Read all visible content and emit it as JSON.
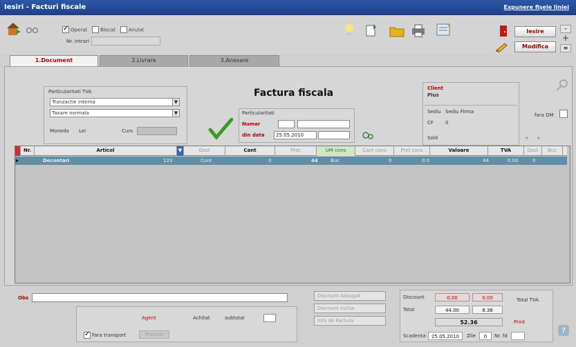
{
  "window": {
    "title": "Iesiri - Facturi fiscale",
    "top_link": "Expunere fișele liniei"
  },
  "toolbar": {
    "flags": [
      {
        "label": "Operat",
        "checked": true
      },
      {
        "label": "Blocat",
        "checked": false
      },
      {
        "label": "Anulat",
        "checked": false
      }
    ],
    "nr_intrari_label": "Nr. intrari",
    "save_label": "Iesire",
    "modify_label": "Modifica"
  },
  "tabs": [
    {
      "label": "1.Document",
      "active": true
    },
    {
      "label": "2.Livrare",
      "active": false
    },
    {
      "label": "3.Anexare",
      "active": false
    }
  ],
  "doc": {
    "particularitati_title": "Particularitati TVA",
    "tranzactie": "Tranzactie interna",
    "taxare": "Taxare normala",
    "moneda_label": "Moneda",
    "moneda_value": "Lei",
    "curs_label": "Curs",
    "heading": "Factura fiscala",
    "partid_title": "Particularitati",
    "numar_label": "Numar",
    "din_data_label": "din data",
    "din_data_value": "25.05.2010",
    "client_label": "Client",
    "client_name": "Plus",
    "sediu_label": "Sediu",
    "sediu_value": "Sediu Firma",
    "cui_label": "CF",
    "cui_value": "0",
    "sold_label": "Sold",
    "fara_dm_label": "fara DM"
  },
  "grid": {
    "columns": [
      "Nr.",
      "Articol",
      "Gest",
      "Cant",
      "Pret",
      "UM cons",
      "Cant cons",
      "Pret cons",
      "Valoare",
      "TVA",
      "Gest",
      "Buc"
    ],
    "rows": [
      {
        "nr": "",
        "articol": "Decontari",
        "cod": "123",
        "gest": "Cont",
        "cant": "0",
        "pret": "44",
        "um": "Buc",
        "cant_cons": "0",
        "pret_cons": "0.0",
        "valoare": "44",
        "tva": "0.00",
        "g2": "0"
      }
    ]
  },
  "bottom": {
    "obs_label": "Obs",
    "buttons": [
      "Discount Adaugat",
      "Discount Inclus",
      "Info de Factura"
    ],
    "agent_label": "Agent",
    "achitat_label": "Achitat",
    "subtotal_label": "subtotal",
    "fara_transport_label": "Fara transport",
    "procent_label": "Procent",
    "discount_label": "Discount",
    "total_label": "Total",
    "discount_vals": [
      "0.00",
      "0.00"
    ],
    "total_vals": [
      "44.00",
      "8.36"
    ],
    "grand_total": "52.36",
    "scadenta_label": "Scadenta",
    "scadenta_value": "25.05.2010",
    "zile_label": "Zile",
    "zile_value": "0",
    "nr_label": "Nr. fd",
    "print_label": "Print",
    "total_gen_label": "Total TVA"
  },
  "colors": {
    "title_bar": "#2f57a8",
    "row_selected": "#5f8fa8",
    "accent_red": "#b00000",
    "check_green": "#3a9a2a"
  }
}
